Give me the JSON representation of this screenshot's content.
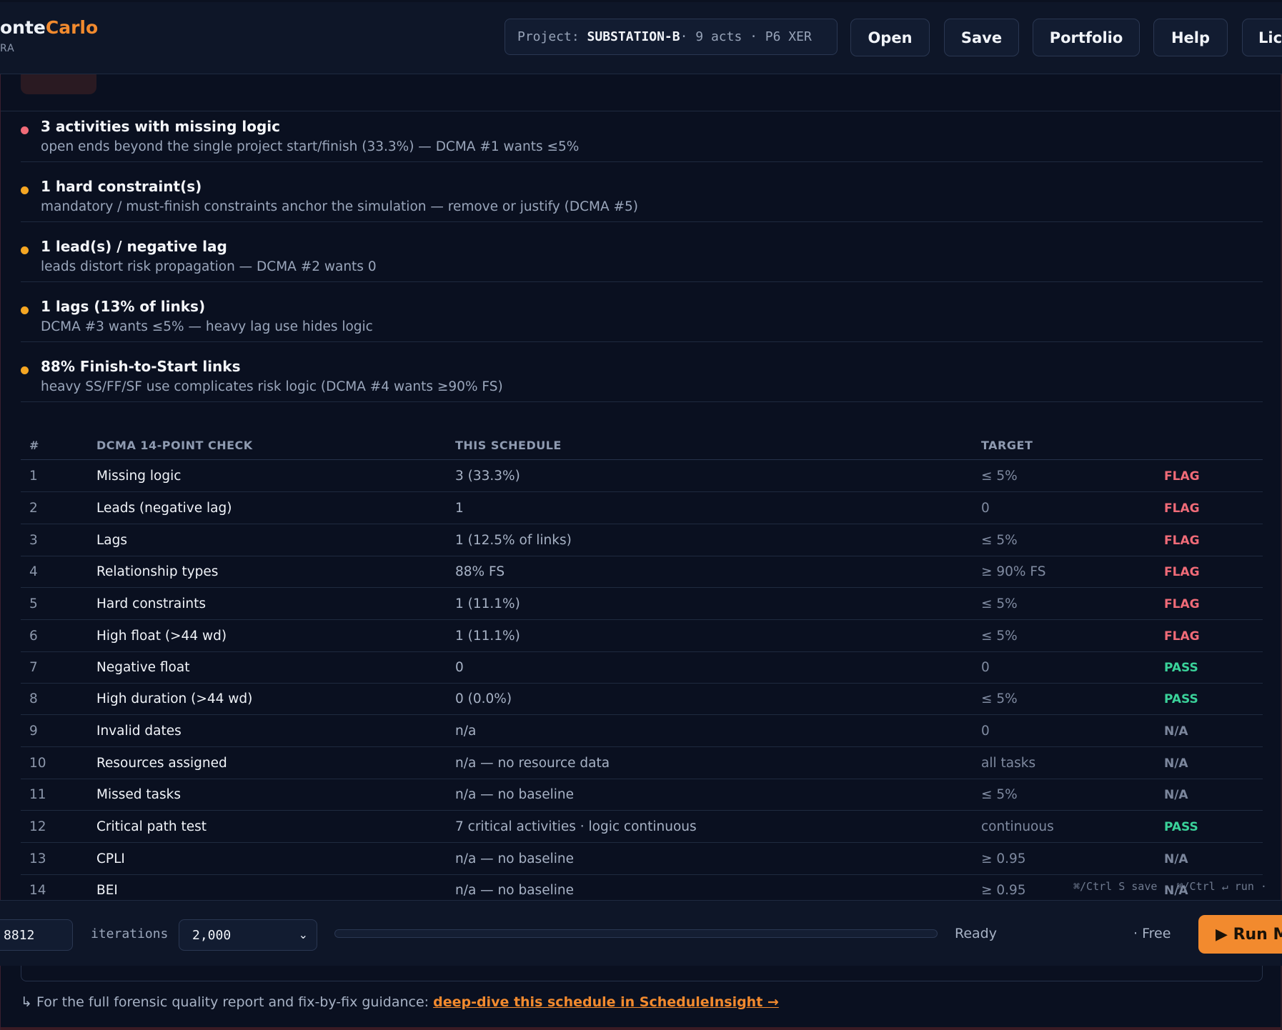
{
  "header": {
    "brand_part1": "onte",
    "brand_part2": "Carlo",
    "brand_sub": "RA",
    "project_label": "Project:",
    "project_name": "SUBSTATION-B",
    "project_meta": " · 9 acts · P6 XER",
    "buttons": {
      "open": "Open",
      "save": "Save",
      "portfolio": "Portfolio",
      "help": "Help",
      "license": "Lic"
    }
  },
  "issues": [
    {
      "title": "3 activities with missing logic",
      "desc": "open ends beyond the single project start/finish (33.3%) — DCMA #1 wants ≤5%",
      "severity": "high"
    },
    {
      "title": "1 hard constraint(s)",
      "desc": "mandatory / must-finish constraints anchor the simulation — remove or justify (DCMA #5)",
      "severity": "medium"
    },
    {
      "title": "1 lead(s) / negative lag",
      "desc": "leads distort risk propagation — DCMA #2 wants 0",
      "severity": "medium"
    },
    {
      "title": "1 lags (13% of links)",
      "desc": "DCMA #3 wants ≤5% — heavy lag use hides logic",
      "severity": "medium"
    },
    {
      "title": "88% Finish-to-Start links",
      "desc": "heavy SS/FF/SF use complicates risk logic (DCMA #4 wants ≥90% FS)",
      "severity": "medium"
    }
  ],
  "table": {
    "headers": {
      "num": "#",
      "check": "DCMA 14-POINT CHECK",
      "value": "THIS SCHEDULE",
      "target": "TARGET"
    },
    "rows": [
      {
        "num": "1",
        "check": "Missing logic",
        "value": "3 (33.3%)",
        "target": "≤ 5%",
        "status": "FLAG"
      },
      {
        "num": "2",
        "check": "Leads (negative lag)",
        "value": "1",
        "target": "0",
        "status": "FLAG"
      },
      {
        "num": "3",
        "check": "Lags",
        "value": "1 (12.5% of links)",
        "target": "≤ 5%",
        "status": "FLAG"
      },
      {
        "num": "4",
        "check": "Relationship types",
        "value": "88% FS",
        "target": "≥ 90% FS",
        "status": "FLAG"
      },
      {
        "num": "5",
        "check": "Hard constraints",
        "value": "1 (11.1%)",
        "target": "≤ 5%",
        "status": "FLAG"
      },
      {
        "num": "6",
        "check": "High float (>44 wd)",
        "value": "1 (11.1%)",
        "target": "≤ 5%",
        "status": "FLAG"
      },
      {
        "num": "7",
        "check": "Negative float",
        "value": "0",
        "target": "0",
        "status": "PASS"
      },
      {
        "num": "8",
        "check": "High duration (>44 wd)",
        "value": "0 (0.0%)",
        "target": "≤ 5%",
        "status": "PASS"
      },
      {
        "num": "9",
        "check": "Invalid dates",
        "value": "n/a",
        "target": "0",
        "status": "N/A"
      },
      {
        "num": "10",
        "check": "Resources assigned",
        "value": "n/a — no resource data",
        "target": "all tasks",
        "status": "N/A"
      },
      {
        "num": "11",
        "check": "Missed tasks",
        "value": "n/a — no baseline",
        "target": "≤ 5%",
        "status": "N/A"
      },
      {
        "num": "12",
        "check": "Critical path test",
        "value": "7 critical activities · logic continuous",
        "target": "continuous",
        "status": "PASS"
      },
      {
        "num": "13",
        "check": "CPLI",
        "value": "n/a — no baseline",
        "target": "≥ 0.95",
        "status": "N/A"
      },
      {
        "num": "14",
        "check": "BEI",
        "value": "n/a — no baseline",
        "target": "≥ 0.95",
        "status": "N/A"
      }
    ]
  },
  "shortcut_hint": "⌘/Ctrl S save · ⌘/Ctrl ↵ run ·",
  "runbar": {
    "seed_value": "8812",
    "iterations_label": "iterations",
    "iterations_value": "2,000",
    "progress": 0,
    "status": "Ready",
    "plan": "· Free",
    "run_label": "▶ Run M"
  },
  "footer": {
    "prefix": "↳ For the full forensic quality report and fix-by-fix guidance: ",
    "link_text": "deep-dive this schedule in ScheduleInsight →"
  },
  "colors": {
    "accent": "#f28a2e",
    "flag": "#f06b78",
    "pass": "#3ad29a",
    "na": "#7c879d",
    "severity_high": "#f06b78",
    "severity_medium": "#f5a623"
  }
}
